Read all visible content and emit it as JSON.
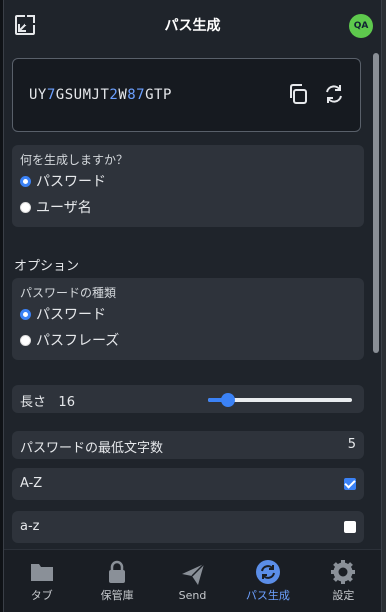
{
  "header": {
    "title": "パス生成",
    "avatar": "QA"
  },
  "password": {
    "segments": [
      {
        "t": "UY",
        "d": false
      },
      {
        "t": "7",
        "d": true
      },
      {
        "t": "GSUMJT",
        "d": false
      },
      {
        "t": "2",
        "d": true
      },
      {
        "t": "W",
        "d": false
      },
      {
        "t": "87",
        "d": true
      },
      {
        "t": "GTP",
        "d": false
      }
    ]
  },
  "generate": {
    "question": "何を生成しますか？",
    "options": [
      {
        "label": "パスワード",
        "selected": true
      },
      {
        "label": "ユーザ名",
        "selected": false
      }
    ]
  },
  "options_title": "オプション",
  "pw_type": {
    "label": "パスワードの種類",
    "options": [
      {
        "label": "パスワード",
        "selected": true
      },
      {
        "label": "パスフレーズ",
        "selected": false
      }
    ]
  },
  "length": {
    "label": "長さ",
    "value": "16",
    "slider_fraction": 0.14
  },
  "min_chars": {
    "label": "パスワードの最低文字数",
    "value": "5"
  },
  "charsets": [
    {
      "label": "A-Z",
      "checked": true
    },
    {
      "label": "a-z",
      "checked": false
    }
  ],
  "tabs": [
    {
      "label": "タブ",
      "icon": "folder-icon",
      "active": false
    },
    {
      "label": "保管庫",
      "icon": "lock-icon",
      "active": false
    },
    {
      "label": "Send",
      "icon": "paper-plane-icon",
      "active": false
    },
    {
      "label": "パス生成",
      "icon": "generate-icon",
      "active": true
    },
    {
      "label": "設定",
      "icon": "gear-icon",
      "active": false
    }
  ],
  "colors": {
    "accent": "#3b82f6",
    "digit": "#6ca0ff",
    "avatar": "#5ec94d"
  }
}
